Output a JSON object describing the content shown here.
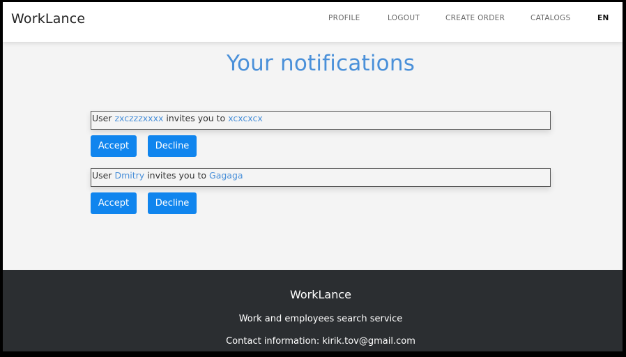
{
  "navbar": {
    "brand": "WorkLance",
    "links": {
      "profile": "PROFILE",
      "logout": "LOGOUT",
      "create_order": "CREATE ORDER",
      "catalogs": "CATALOGS",
      "language": "EN"
    }
  },
  "page": {
    "title": "Your notifications"
  },
  "notifications": [
    {
      "prefix": "User",
      "user": "zxczzzxxxx",
      "middle": "invites you to",
      "project": "xcxcxcx",
      "accept_label": "Accept",
      "decline_label": "Decline"
    },
    {
      "prefix": "User",
      "user": "Dmitry",
      "middle": "invites you to",
      "project": "Gagaga",
      "accept_label": "Accept",
      "decline_label": "Decline"
    }
  ],
  "footer": {
    "brand": "WorkLance",
    "tagline": "Work and employees search service",
    "contact": "Contact information: kirik.tov@gmail.com"
  },
  "colors": {
    "accent": "#4a90d9",
    "button": "#1085ee",
    "footer_bg": "#2b2e31",
    "page_bg": "#f4f4f4"
  }
}
